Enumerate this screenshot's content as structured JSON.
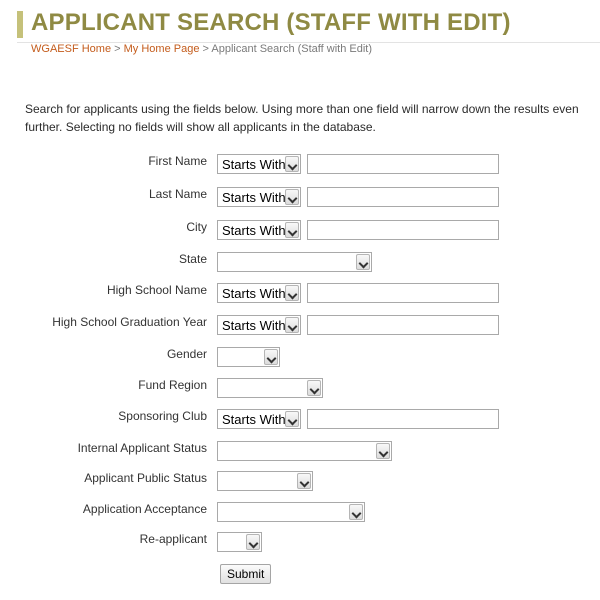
{
  "header": {
    "title": "APPLICANT SEARCH (STAFF WITH EDIT)"
  },
  "breadcrumb": {
    "items": [
      "WGAESF Home",
      "My Home Page"
    ],
    "separator": ">",
    "current": "Applicant Search (Staff with Edit)"
  },
  "intro": "Search for applicants using the fields below. Using more than one field will narrow down the results even further. Selecting no fields will show all applicants in the database.",
  "fields": {
    "first_name": {
      "label": "First Name",
      "mode": "Starts With",
      "value": ""
    },
    "last_name": {
      "label": "Last Name",
      "mode": "Starts With",
      "value": ""
    },
    "city": {
      "label": "City",
      "mode": "Starts With",
      "value": ""
    },
    "state": {
      "label": "State",
      "value": ""
    },
    "high_school_name": {
      "label": "High School Name",
      "mode": "Starts With",
      "value": ""
    },
    "hs_grad_year": {
      "label": "High School Graduation Year",
      "mode": "Starts With",
      "value": ""
    },
    "gender": {
      "label": "Gender",
      "value": ""
    },
    "fund_region": {
      "label": "Fund Region",
      "value": ""
    },
    "sponsoring_club": {
      "label": "Sponsoring Club",
      "mode": "Starts With",
      "value": ""
    },
    "internal_status": {
      "label": "Internal Applicant Status",
      "value": ""
    },
    "public_status": {
      "label": "Applicant Public Status",
      "value": ""
    },
    "acceptance": {
      "label": "Application Acceptance",
      "value": ""
    },
    "reapplicant": {
      "label": "Re-applicant",
      "value": ""
    }
  },
  "submit_label": "Submit",
  "colors": {
    "title": "#8f8a43",
    "accent_bar": "#c5c17a",
    "link": "#c45c1c"
  }
}
